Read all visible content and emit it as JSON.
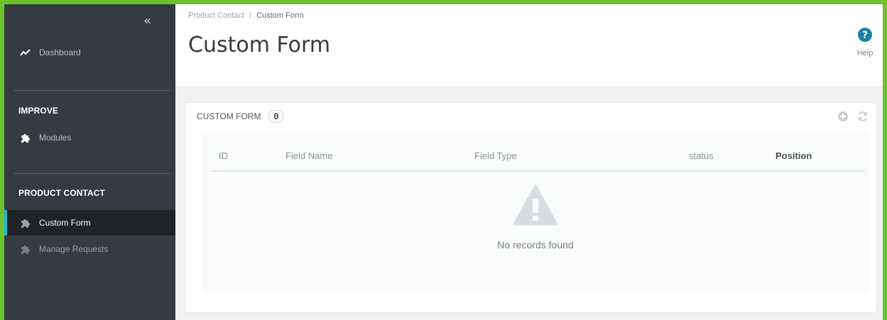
{
  "sidebar": {
    "collapse_glyph": "«",
    "dashboard_label": "Dashboard",
    "section_improve": "IMPROVE",
    "modules_label": "Modules",
    "section_product_contact": "PRODUCT CONTACT",
    "custom_form_label": "Custom Form",
    "manage_requests_label": "Manage Requests"
  },
  "header": {
    "breadcrumb_parent": "Product Contact",
    "breadcrumb_sep": "/",
    "breadcrumb_current": "Custom Form",
    "title": "Custom Form",
    "help_label": "Help"
  },
  "panel": {
    "title": "CUSTOM FORM",
    "count": "0",
    "columns": [
      "ID",
      "Field Name",
      "Field Type",
      "status",
      "Position"
    ],
    "empty_text": "No records found"
  },
  "colors": {
    "accent": "#25b9d7",
    "frame_border": "#6ec12f",
    "sidebar_bg": "#363a41",
    "help_icon": "#1b7fa3"
  }
}
